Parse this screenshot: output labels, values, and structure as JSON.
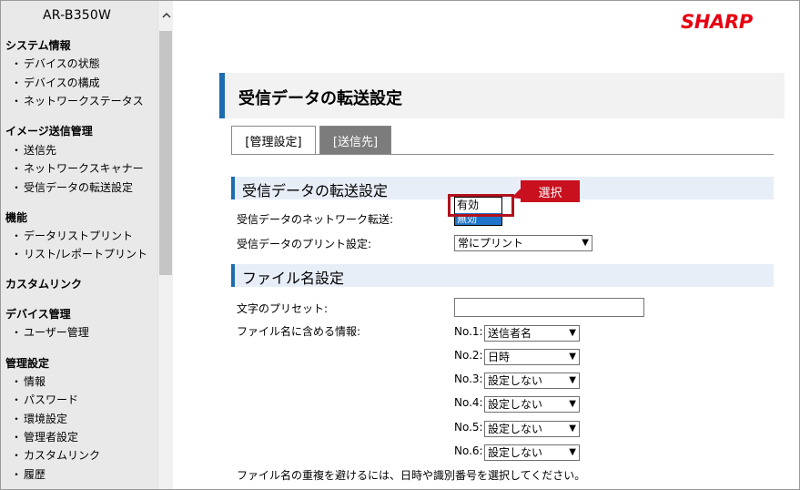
{
  "header": {
    "model": "AR-B350W",
    "logo": "SHARP"
  },
  "sidebar": {
    "groups": [
      {
        "title": "システム情報",
        "items": [
          "デバイスの状態",
          "デバイスの構成",
          "ネットワークステータス"
        ]
      },
      {
        "title": "イメージ送信管理",
        "items": [
          "送信先",
          "ネットワークスキャナー",
          "受信データの転送設定"
        ]
      },
      {
        "title": "機能",
        "items": [
          "データリストプリント",
          "リスト/レポートプリント"
        ]
      },
      {
        "title": "カスタムリンク",
        "items": []
      },
      {
        "title": "デバイス管理",
        "items": [
          "ユーザー管理"
        ]
      },
      {
        "title": "管理設定",
        "items": [
          "情報",
          "パスワード",
          "環境設定",
          "管理者設定",
          "カスタムリンク",
          "履歴"
        ]
      }
    ],
    "bullet": "・",
    "scroll_up_icon": "chevron-up-icon"
  },
  "main": {
    "page_title": "受信データの転送設定",
    "tabs": [
      "[管理設定]",
      "[送信先]"
    ],
    "section1": {
      "title": "受信データの転送設定",
      "forward_label": "受信データのネットワーク転送:",
      "forward_options": [
        "有効",
        "無効"
      ],
      "print_label": "受信データのプリント設定:",
      "print_value": "常にプリント"
    },
    "callout": "選択",
    "section2": {
      "title": "ファイル名設定",
      "preset_label": "文字のプリセット:",
      "preset_value": "",
      "include_label": "ファイル名に含める情報:",
      "fields": [
        {
          "no": "No.1:",
          "value": "送信者名"
        },
        {
          "no": "No.2:",
          "value": "日時"
        },
        {
          "no": "No.3:",
          "value": "設定しない"
        },
        {
          "no": "No.4:",
          "value": "設定しない"
        },
        {
          "no": "No.5:",
          "value": "設定しない"
        },
        {
          "no": "No.6:",
          "value": "設定しない"
        }
      ],
      "note": "ファイル名の重複を避けるには、日時や識別番号を選択してください。"
    }
  }
}
